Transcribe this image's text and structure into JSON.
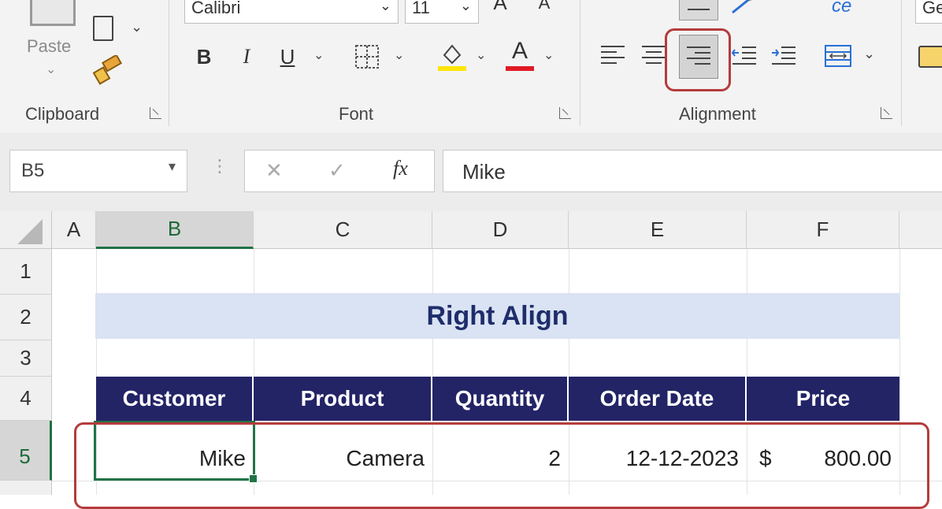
{
  "ribbon": {
    "font_name": "Calibri",
    "font_size": "11",
    "paste_label": "Paste",
    "groups": {
      "clipboard": "Clipboard",
      "font": "Font",
      "alignment": "Alignment"
    },
    "font_buttons": {
      "bold": "B",
      "italic": "I",
      "underline": "U"
    },
    "number_format_partial": "Ge"
  },
  "formula_bar": {
    "name_box": "B5",
    "cancel": "✕",
    "enter": "✓",
    "fx": "fx",
    "content": "Mike"
  },
  "grid": {
    "columns": [
      "A",
      "B",
      "C",
      "D",
      "E",
      "F"
    ],
    "rows": [
      "1",
      "2",
      "3",
      "4",
      "5"
    ],
    "selected_cell": "B5"
  },
  "sheet": {
    "title": "Right Align",
    "headers": [
      "Customer",
      "Product",
      "Quantity",
      "Order Date",
      "Price"
    ],
    "row5": {
      "customer": "Mike",
      "product": "Camera",
      "quantity": "2",
      "order_date": "12-12-2023",
      "currency": "$",
      "price": "800.00"
    }
  },
  "colors": {
    "header_bg": "#232466",
    "title_band_bg": "#dae3f3",
    "selection": "#217346",
    "highlight_box": "#b43c3c"
  }
}
